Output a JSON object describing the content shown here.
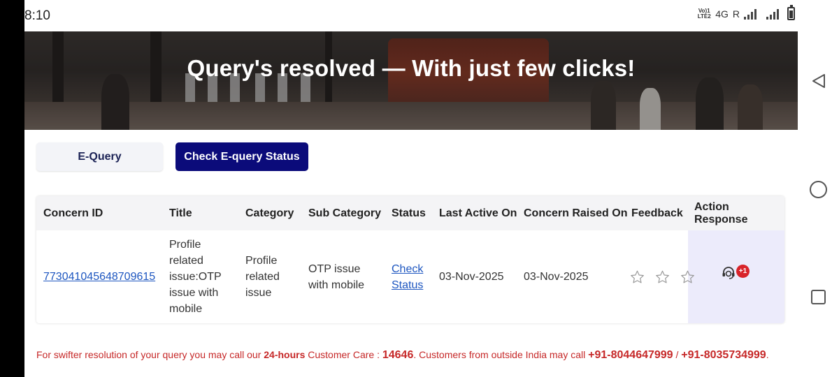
{
  "status_bar": {
    "time": "8:10",
    "volte_line1": "Vo)1",
    "volte_line2": "LTE2",
    "network": "4G",
    "roaming": "R"
  },
  "hero": {
    "title": "Query's resolved — With just few clicks!"
  },
  "tabs": {
    "equery_label": "E-Query",
    "check_status_label": "Check E-query Status",
    "active_tab": "Check E-query Status",
    "active_color": "#0b0b7a"
  },
  "table": {
    "headers": [
      "Concern ID",
      "Title",
      "Category",
      "Sub Category",
      "Status",
      "Last Active On",
      "Concern Raised On",
      "Feedback",
      "Action Response"
    ],
    "rows": [
      {
        "concern_id": "773041045648709615",
        "title_lines": [
          "Profile",
          "related",
          "issue:OTP",
          "issue with",
          "mobile"
        ],
        "category_lines": [
          "Profile",
          "related",
          "issue"
        ],
        "sub_category_lines": [
          "OTP issue",
          "with mobile"
        ],
        "status_lines": [
          "Check",
          "Status"
        ],
        "last_active_on": "03-Nov-2025",
        "concern_raised_on": "03-Nov-2025",
        "feedback_rating": 0,
        "feedback_max": 3,
        "action_badge": "+1",
        "action_icon": "support-agent-icon"
      }
    ]
  },
  "footer": {
    "text1": "For swifter resolution of your query you may call our ",
    "hours": "24-hours",
    "text2": " Customer Care : ",
    "care_number": "14646",
    "text3": ". Customers from outside India may call ",
    "intl1": "+91-8044647999",
    "sep": " / ",
    "intl2": "+91-8035734999",
    "end": "."
  },
  "colors": {
    "link": "#1d56c0",
    "footer_text": "#c62828",
    "badge": "#d8232a",
    "action_bg": "#ecebfb"
  }
}
